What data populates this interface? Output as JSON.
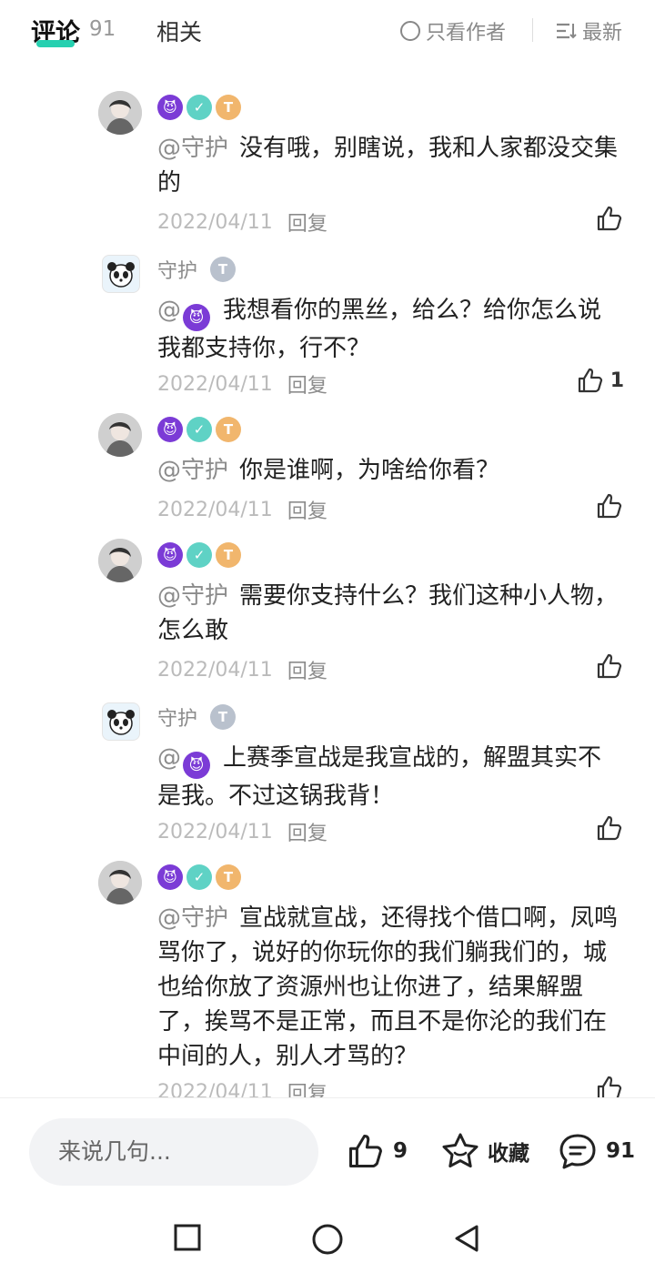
{
  "header": {
    "tab_comments": "评论",
    "comment_count": "91",
    "tab_related": "相关",
    "only_author": "只看作者",
    "sort_label": "最新"
  },
  "comments": [
    {
      "name": "",
      "badges": [
        "devil-icon",
        "teal-icon",
        "gold-icon"
      ],
      "mention": "@守护",
      "text": "没有哦，别瞎说，我和人家都没交集的",
      "date": "2022/04/11",
      "reply": "回复",
      "likes": ""
    },
    {
      "name": "守护",
      "badges": [
        "silver-icon"
      ],
      "mention": "@",
      "text": "我想看你的黑丝，给么？给你怎么说我都支持你，行不？",
      "date": "2022/04/11",
      "reply": "回复",
      "likes": "1"
    },
    {
      "name": "",
      "badges": [
        "devil-icon",
        "teal-icon",
        "gold-icon"
      ],
      "mention": "@守护",
      "text": "你是谁啊，为啥给你看？",
      "date": "2022/04/11",
      "reply": "回复",
      "likes": ""
    },
    {
      "name": "",
      "badges": [
        "devil-icon",
        "teal-icon",
        "gold-icon"
      ],
      "mention": "@守护",
      "text": "需要你支持什么？我们这种小人物，怎么敢",
      "date": "2022/04/11",
      "reply": "回复",
      "likes": ""
    },
    {
      "name": "守护",
      "badges": [
        "silver-icon"
      ],
      "mention": "@",
      "text": "上赛季宣战是我宣战的，解盟其实不是我。不过这锅我背！",
      "date": "2022/04/11",
      "reply": "回复",
      "likes": ""
    },
    {
      "name": "",
      "badges": [
        "devil-icon",
        "teal-icon",
        "gold-icon"
      ],
      "mention": "@守护",
      "text": "宣战就宣战，还得找个借口啊，凤鸣骂你了，说好的你玩你的我们躺我们的，城也给你放了资源州也让你进了，结果解盟了，挨骂不是正常，而且不是你沦的我们在中间的人，别人才骂的？",
      "date": "2022/04/11",
      "reply": "回复",
      "likes": ""
    }
  ],
  "bottom": {
    "input_placeholder": "来说几句...",
    "like_count": "9",
    "favorite_label": "收藏",
    "comment_count": "91"
  },
  "colors": {
    "accent": "#26d0b0",
    "muted": "#8c8c8c",
    "date": "#bbbbbb",
    "devil": "#7b3bd6"
  }
}
